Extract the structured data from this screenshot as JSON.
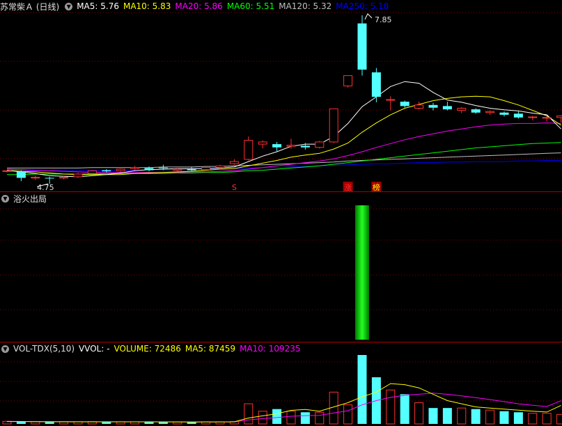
{
  "header_main": {
    "title": "苏常柴Ａ (日线)",
    "ma": [
      {
        "label": "MA5: 5.76",
        "color": "#ffffff"
      },
      {
        "label": "MA10: 5.83",
        "color": "#ffff00"
      },
      {
        "label": "MA20: 5.86",
        "color": "#ff00ff"
      },
      {
        "label": "MA60: 5.51",
        "color": "#00ff00"
      },
      {
        "label": "MA120: 5.32",
        "color": "#c0c0c0"
      },
      {
        "label": "MA250: 5.18",
        "color": "#0000ff"
      }
    ]
  },
  "header_indicator": {
    "title": "浴火出局"
  },
  "header_volume": {
    "title": "VOL-TDX(5,10)",
    "vvol": "VVOL: -",
    "volume": "VOLUME: 72486",
    "ma5": "MA5: 87459",
    "ma10": "MA10: 109235"
  },
  "colors": {
    "up": "#ff3030",
    "down": "#54ffff",
    "grid": "#8b0000",
    "ma5": "#ffffff",
    "ma10": "#ffff00",
    "ma20": "#ff00ff",
    "ma60": "#00ff00",
    "ma120": "#c0c0c0",
    "ma250": "#0000ff",
    "signal": "#00c000"
  },
  "chart_data": {
    "type": "candlestick",
    "price_annotations": {
      "high_label": "7.85",
      "low_label": "4.75"
    },
    "signal_marks": [
      {
        "index": 16,
        "label": "S",
        "color": "#ff3030"
      },
      {
        "index": 24,
        "label": "涨",
        "color": "#ff3030"
      },
      {
        "index": 26,
        "label": "榜",
        "color": "#ffff00"
      }
    ],
    "candles": [
      {
        "o": 4.98,
        "h": 5.0,
        "l": 4.96,
        "c": 4.99
      },
      {
        "o": 4.98,
        "h": 5.0,
        "l": 4.8,
        "c": 4.86
      },
      {
        "o": 4.86,
        "h": 4.9,
        "l": 4.82,
        "c": 4.87
      },
      {
        "o": 4.86,
        "h": 4.88,
        "l": 4.75,
        "c": 4.85
      },
      {
        "o": 4.86,
        "h": 4.9,
        "l": 4.83,
        "c": 4.87
      },
      {
        "o": 4.88,
        "h": 4.95,
        "l": 4.86,
        "c": 4.93
      },
      {
        "o": 4.94,
        "h": 5.0,
        "l": 4.93,
        "c": 4.99
      },
      {
        "o": 5.0,
        "h": 5.02,
        "l": 4.96,
        "c": 4.98
      },
      {
        "o": 4.99,
        "h": 5.03,
        "l": 4.97,
        "c": 5.02
      },
      {
        "o": 5.03,
        "h": 5.08,
        "l": 5.0,
        "c": 5.05
      },
      {
        "o": 5.04,
        "h": 5.07,
        "l": 4.98,
        "c": 5.0
      },
      {
        "o": 5.05,
        "h": 5.1,
        "l": 5.0,
        "c": 5.04
      },
      {
        "o": 5.0,
        "h": 5.04,
        "l": 4.97,
        "c": 5.02
      },
      {
        "o": 5.02,
        "h": 5.06,
        "l": 4.98,
        "c": 5.0
      },
      {
        "o": 5.01,
        "h": 5.07,
        "l": 5.0,
        "c": 5.05
      },
      {
        "o": 5.05,
        "h": 5.1,
        "l": 5.02,
        "c": 5.08
      },
      {
        "o": 5.12,
        "h": 5.2,
        "l": 5.1,
        "c": 5.16
      },
      {
        "o": 5.2,
        "h": 5.62,
        "l": 5.18,
        "c": 5.55
      },
      {
        "o": 5.48,
        "h": 5.55,
        "l": 5.4,
        "c": 5.52
      },
      {
        "o": 5.48,
        "h": 5.52,
        "l": 5.35,
        "c": 5.42
      },
      {
        "o": 5.44,
        "h": 5.58,
        "l": 5.4,
        "c": 5.46
      },
      {
        "o": 5.45,
        "h": 5.5,
        "l": 5.38,
        "c": 5.42
      },
      {
        "o": 5.42,
        "h": 5.54,
        "l": 5.4,
        "c": 5.52
      },
      {
        "o": 5.52,
        "h": 6.13,
        "l": 5.5,
        "c": 6.13
      },
      {
        "o": 6.55,
        "h": 6.74,
        "l": 6.52,
        "c": 6.74
      },
      {
        "o": 7.7,
        "h": 7.85,
        "l": 6.74,
        "c": 6.85
      },
      {
        "o": 6.8,
        "h": 6.88,
        "l": 6.25,
        "c": 6.35
      },
      {
        "o": 6.3,
        "h": 6.36,
        "l": 6.1,
        "c": 6.3
      },
      {
        "o": 6.26,
        "h": 6.28,
        "l": 6.15,
        "c": 6.18
      },
      {
        "o": 6.14,
        "h": 6.26,
        "l": 6.12,
        "c": 6.2
      },
      {
        "o": 6.2,
        "h": 6.24,
        "l": 6.1,
        "c": 6.15
      },
      {
        "o": 6.18,
        "h": 6.26,
        "l": 6.1,
        "c": 6.12
      },
      {
        "o": 6.1,
        "h": 6.16,
        "l": 6.05,
        "c": 6.14
      },
      {
        "o": 6.12,
        "h": 6.14,
        "l": 6.04,
        "c": 6.06
      },
      {
        "o": 6.06,
        "h": 6.1,
        "l": 6.02,
        "c": 6.08
      },
      {
        "o": 6.06,
        "h": 6.08,
        "l": 5.99,
        "c": 6.02
      },
      {
        "o": 6.04,
        "h": 6.08,
        "l": 5.95,
        "c": 5.97
      },
      {
        "o": 5.98,
        "h": 6.0,
        "l": 5.92,
        "c": 5.98
      },
      {
        "o": 5.96,
        "h": 5.99,
        "l": 5.9,
        "c": 5.97
      },
      {
        "o": 5.97,
        "h": 6.01,
        "l": 5.88,
        "c": 6.0
      }
    ],
    "ma5": [
      5.0,
      4.97,
      4.94,
      4.9,
      4.89,
      4.88,
      4.9,
      4.92,
      4.95,
      4.99,
      5.01,
      5.02,
      5.03,
      5.03,
      5.03,
      5.04,
      5.06,
      5.16,
      5.26,
      5.34,
      5.44,
      5.48,
      5.48,
      5.62,
      5.86,
      6.17,
      6.35,
      6.54,
      6.63,
      6.6,
      6.43,
      6.29,
      6.25,
      6.19,
      6.14,
      6.11,
      6.09,
      6.05,
      6.02,
      5.76
    ],
    "ma10": [
      5.0,
      4.98,
      4.97,
      4.95,
      4.93,
      4.92,
      4.92,
      4.92,
      4.92,
      4.94,
      4.95,
      4.96,
      4.97,
      4.98,
      5.0,
      5.02,
      5.03,
      5.08,
      5.13,
      5.18,
      5.24,
      5.28,
      5.31,
      5.39,
      5.5,
      5.7,
      5.87,
      6.02,
      6.14,
      6.21,
      6.28,
      6.32,
      6.35,
      6.36,
      6.35,
      6.28,
      6.2,
      6.1,
      6.0,
      5.83
    ],
    "ma20": [
      5.02,
      5.01,
      5.0,
      4.99,
      4.98,
      4.97,
      4.96,
      4.96,
      4.96,
      4.96,
      4.96,
      4.96,
      4.96,
      4.97,
      4.97,
      4.98,
      4.99,
      5.02,
      5.05,
      5.08,
      5.11,
      5.14,
      5.17,
      5.21,
      5.27,
      5.34,
      5.42,
      5.49,
      5.56,
      5.62,
      5.67,
      5.72,
      5.76,
      5.8,
      5.83,
      5.85,
      5.86,
      5.86,
      5.87,
      5.86
    ],
    "ma60": [
      4.92,
      4.92,
      4.93,
      4.93,
      4.93,
      4.93,
      4.93,
      4.94,
      4.94,
      4.94,
      4.94,
      4.94,
      4.95,
      4.95,
      4.96,
      4.96,
      4.97,
      4.99,
      5.0,
      5.02,
      5.04,
      5.06,
      5.08,
      5.11,
      5.14,
      5.17,
      5.2,
      5.23,
      5.26,
      5.29,
      5.32,
      5.35,
      5.38,
      5.41,
      5.43,
      5.45,
      5.47,
      5.49,
      5.5,
      5.51
    ],
    "ma120": [
      5.04,
      5.04,
      5.04,
      5.04,
      5.04,
      5.04,
      5.05,
      5.05,
      5.05,
      5.05,
      5.05,
      5.06,
      5.06,
      5.06,
      5.07,
      5.07,
      5.08,
      5.09,
      5.1,
      5.11,
      5.12,
      5.13,
      5.14,
      5.15,
      5.17,
      5.18,
      5.19,
      5.2,
      5.21,
      5.22,
      5.23,
      5.24,
      5.25,
      5.26,
      5.27,
      5.28,
      5.29,
      5.3,
      5.31,
      5.32
    ],
    "ma250": [
      4.98,
      4.98,
      4.99,
      4.99,
      4.99,
      4.99,
      5.0,
      5.0,
      5.0,
      5.0,
      5.01,
      5.01,
      5.01,
      5.02,
      5.02,
      5.02,
      5.03,
      5.04,
      5.05,
      5.05,
      5.06,
      5.07,
      5.08,
      5.09,
      5.1,
      5.11,
      5.12,
      5.12,
      5.13,
      5.14,
      5.14,
      5.15,
      5.15,
      5.16,
      5.16,
      5.16,
      5.17,
      5.17,
      5.18,
      5.18
    ],
    "indicator": {
      "bar_index": 25,
      "value": 1
    },
    "volume": [
      12000,
      11000,
      10000,
      9000,
      9500,
      10000,
      11000,
      10000,
      9500,
      10000,
      9000,
      9500,
      9000,
      9000,
      10000,
      10000,
      11000,
      95000,
      60000,
      70000,
      60000,
      55000,
      55000,
      150000,
      90000,
      325000,
      220000,
      160000,
      140000,
      100000,
      75000,
      75000,
      75000,
      70000,
      65000,
      60000,
      55000,
      50000,
      50000,
      45000
    ],
    "vol_ma5": [
      11000,
      11000,
      10500,
      10200,
      10100,
      10000,
      9900,
      9800,
      9900,
      9900,
      9900,
      9600,
      9400,
      9300,
      9500,
      9500,
      9800,
      28000,
      38000,
      48000,
      64000,
      68000,
      60000,
      80000,
      100000,
      128000,
      150000,
      190000,
      185000,
      170000,
      140000,
      110000,
      95000,
      80000,
      75000,
      70000,
      65000,
      60000,
      56000,
      87459
    ],
    "vol_ma10": [
      12000,
      11600,
      11200,
      10900,
      10600,
      10400,
      10300,
      10200,
      10100,
      10000,
      9900,
      9800,
      9700,
      9600,
      9600,
      9600,
      9600,
      19000,
      25000,
      30000,
      36000,
      39000,
      40000,
      52000,
      62000,
      90000,
      110000,
      125000,
      135000,
      140000,
      145000,
      140000,
      132000,
      124000,
      115000,
      105000,
      95000,
      88000,
      82000,
      109235
    ],
    "volume_max": 325000,
    "price_range": [
      4.7,
      7.9
    ]
  }
}
